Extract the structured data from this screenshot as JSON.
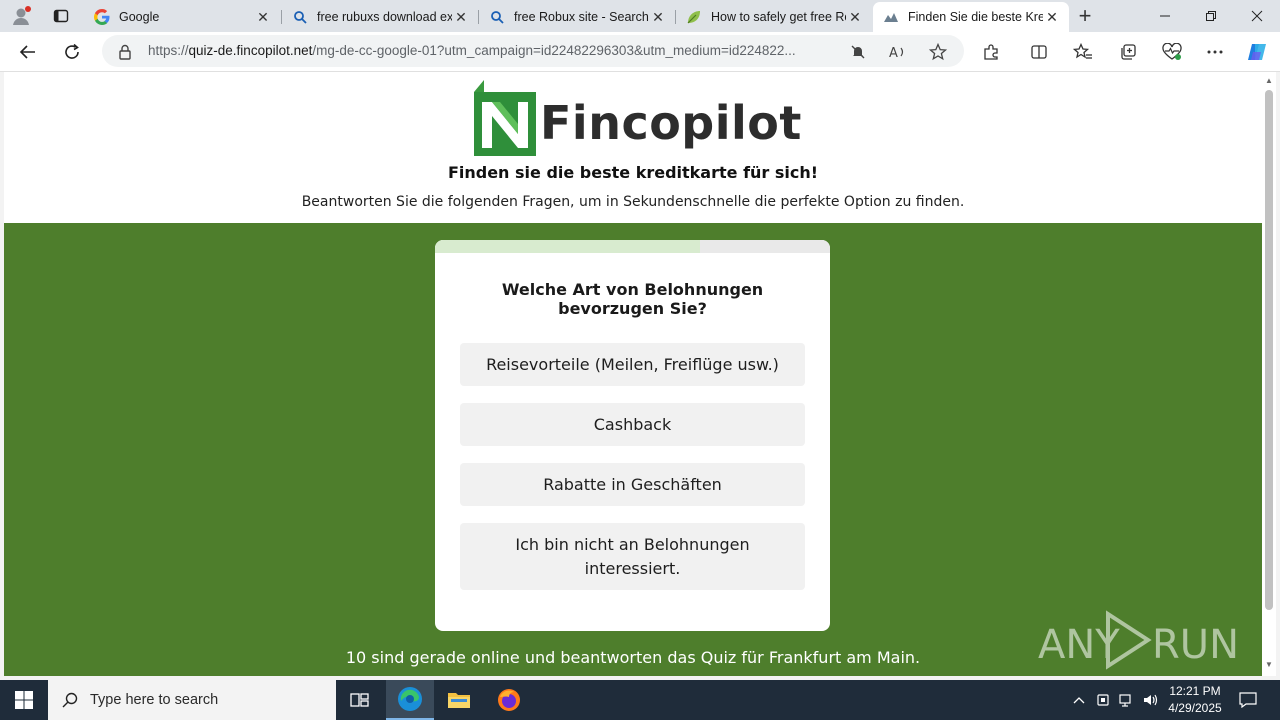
{
  "browser": {
    "tabs": [
      {
        "title": "Google",
        "icon": "google-icon",
        "active": false
      },
      {
        "title": "free rubuxs download ex",
        "icon": "search-icon",
        "active": false
      },
      {
        "title": "free Robux site - Search",
        "icon": "search-icon",
        "active": false
      },
      {
        "title": "How to safely get free Ro",
        "icon": "leaf-favicon",
        "active": false
      },
      {
        "title": "Finden Sie die beste Kred",
        "icon": "chart-favicon",
        "active": true
      }
    ],
    "url": {
      "prefix": "https://",
      "host": "quiz-de.fincopilot.net",
      "path": "/mg-de-cc-google-01?utm_campaign=id22482296303&utm_medium=id224822..."
    }
  },
  "page": {
    "logo_text": "Fincopilot",
    "headline": "Finden sie die beste kreditkarte für sich!",
    "subline": "Beantworten Sie die folgenden Fragen, um in Sekundenschnelle die perfekte Option zu finden.",
    "quiz": {
      "progress": 0.67,
      "question": "Welche Art von Belohnungen bevorzugen Sie?",
      "options": [
        "Reisevorteile (Meilen, Freiflüge usw.)",
        "Cashback",
        "Rabatte in Geschäften",
        "Ich bin nicht an Belohnungen interessiert."
      ]
    },
    "online_text": "10 sind gerade online und beantworten das Quiz für Frankfurt am Main."
  },
  "watermark": {
    "text_left": "ANY",
    "text_right": "RUN"
  },
  "taskbar": {
    "search_placeholder": "Type here to search",
    "time": "12:21 PM",
    "date": "4/29/2025"
  },
  "colors": {
    "brand_green": "#4e7e2c",
    "logo_green": "#2f8f3a",
    "progress_fill": "#d8ebcf",
    "option_bg": "#f1f1f1"
  }
}
